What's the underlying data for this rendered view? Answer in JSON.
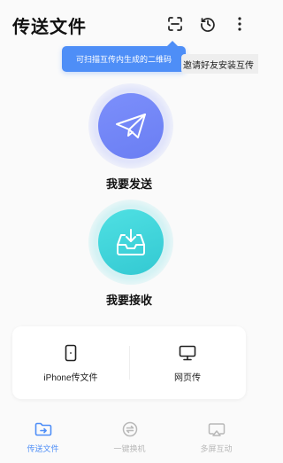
{
  "header": {
    "title": "传送文件",
    "icons": [
      "scan-icon",
      "history-icon",
      "more-icon"
    ]
  },
  "tooltip": {
    "text": "可扫描互传内生成的二维码"
  },
  "invite": {
    "text": "邀请好友安装互传"
  },
  "actions": {
    "send_label": "我要发送",
    "receive_label": "我要接收"
  },
  "tools": {
    "iphone_label": "iPhone传文件",
    "web_label": "网页传"
  },
  "tabs": [
    {
      "label": "传送文件",
      "icon": "folder-transfer-icon",
      "active": true
    },
    {
      "label": "一键换机",
      "icon": "swap-icon",
      "active": false
    },
    {
      "label": "多屏互动",
      "icon": "screen-cast-icon",
      "active": false
    }
  ],
  "colors": {
    "accent": "#4e8ef7",
    "send": "#7283f7",
    "receive": "#40d3da",
    "inactive": "#b8b8b8"
  }
}
